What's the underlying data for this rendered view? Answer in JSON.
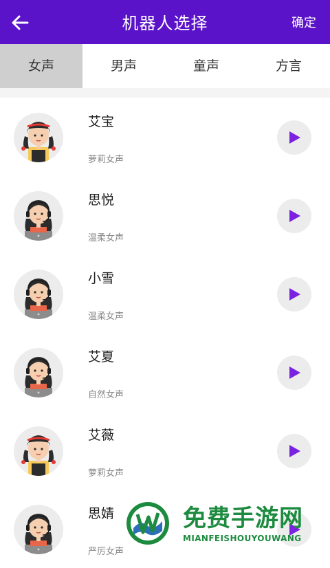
{
  "header": {
    "title": "机器人选择",
    "confirm_label": "确定"
  },
  "tabs": [
    {
      "label": "女声",
      "active": true
    },
    {
      "label": "男声",
      "active": false
    },
    {
      "label": "童声",
      "active": false
    },
    {
      "label": "方言",
      "active": false
    }
  ],
  "robots": [
    {
      "name": "艾宝",
      "desc": "萝莉女声",
      "avatar": "braided-girl-avatar"
    },
    {
      "name": "思悦",
      "desc": "温柔女声",
      "avatar": "headset-woman-avatar"
    },
    {
      "name": "小雪",
      "desc": "温柔女声",
      "avatar": "headset-woman-avatar"
    },
    {
      "name": "艾夏",
      "desc": "自然女声",
      "avatar": "headset-woman-avatar"
    },
    {
      "name": "艾薇",
      "desc": "萝莉女声",
      "avatar": "braided-girl-avatar"
    },
    {
      "name": "思婧",
      "desc": "严厉女声",
      "avatar": "headset-woman-avatar"
    }
  ],
  "watermark": {
    "cn": "免费手游网",
    "en": "MIANFEISHOUYOUWANG"
  },
  "colors": {
    "header_bg": "#5b13c9",
    "play_icon": "#7a22e0",
    "active_tab_bg": "#cfcfcf"
  }
}
